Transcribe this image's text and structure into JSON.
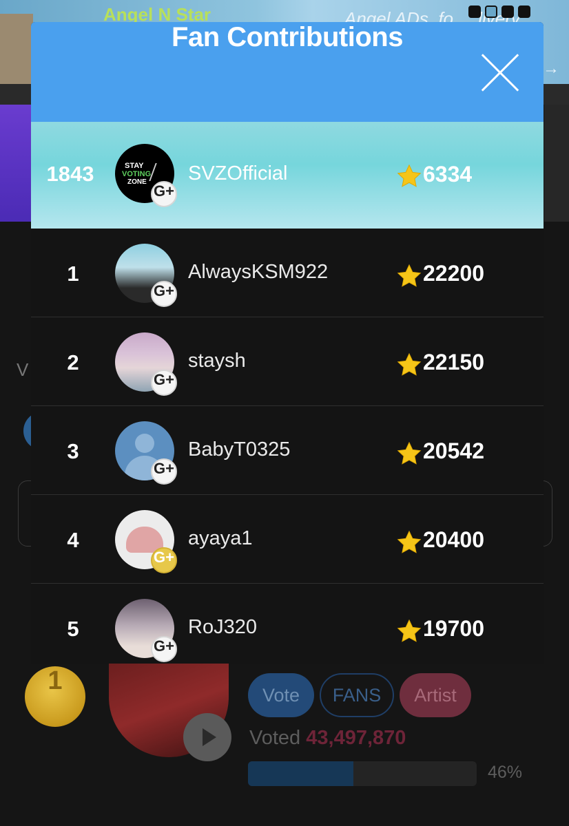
{
  "background": {
    "banner": {
      "brand": "Angel N Star",
      "ads_text": "Angel ADs. fo",
      "ads_text_end": "livery"
    },
    "partial_letter": "V",
    "voting_card": {
      "rank": "1",
      "vote_label": "Vote",
      "fans_label": "FANS",
      "artist_label": "Artist",
      "voted_prefix": "Voted",
      "voted_count": "43,497,870",
      "progress_text": "46%",
      "progress_fraction": 0.46
    }
  },
  "modal": {
    "title": "Fan Contributions",
    "my_entry": {
      "rank": "1843",
      "username": "SVZOfficial",
      "score": "6334",
      "avatar_lines": [
        "STAY",
        "VOTING",
        "ZONE"
      ],
      "badge": "G+"
    },
    "rankings": [
      {
        "rank": "1",
        "username": "AlwaysKSM922",
        "score": "22200",
        "badge": "G+"
      },
      {
        "rank": "2",
        "username": "staysh",
        "score": "22150",
        "badge": "G+"
      },
      {
        "rank": "3",
        "username": "BabyT0325",
        "score": "20542",
        "badge": "G+"
      },
      {
        "rank": "4",
        "username": "ayaya1",
        "score": "20400",
        "badge": "G+"
      },
      {
        "rank": "5",
        "username": "RoJ320",
        "score": "19700",
        "badge": "G+"
      }
    ]
  },
  "colors": {
    "header_blue": "#4aa0ee",
    "my_row_teal": "#76d6dc",
    "star_yellow": "#f5c518",
    "voted_count_red": "#6e2438"
  },
  "icons": {
    "close": "close-icon",
    "star": "star-icon",
    "badge": "g-plus-badge-icon",
    "play": "play-icon",
    "medal": "gold-medal-icon"
  }
}
